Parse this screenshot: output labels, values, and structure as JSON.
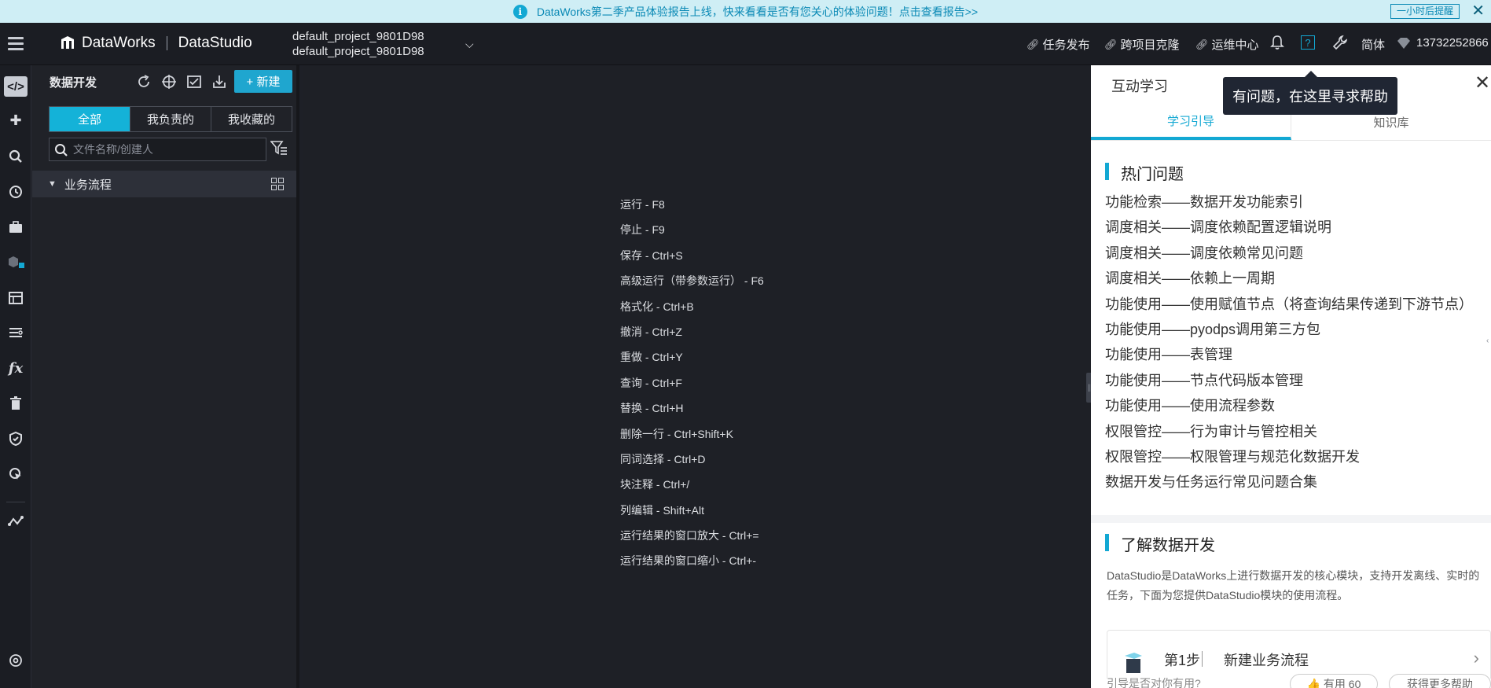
{
  "announcement": {
    "text": "DataWorks第二季产品体验报告上线，快来看看是否有您关心的体验问题！点击查看报告>>",
    "remind_label": "一小时后提醒",
    "info_glyph": "i",
    "close_glyph": "✕"
  },
  "header": {
    "brand": "DataWorks",
    "module": "DataStudio",
    "project_lines": [
      "default_project_9801D98",
      "default_project_9801D98"
    ],
    "nav": [
      {
        "label": "任务发布",
        "icon": "link-icon"
      },
      {
        "label": "跨项目克隆",
        "icon": "link-icon"
      },
      {
        "label": "运维中心",
        "icon": "link-icon"
      }
    ],
    "lang": "简体",
    "user": "13732252866",
    "help_icon_glyph": "?"
  },
  "explorer": {
    "title": "数据开发",
    "new_button": "+ 新建",
    "tabs": [
      {
        "label": "全部",
        "selected": true
      },
      {
        "label": "我负责的",
        "selected": false
      },
      {
        "label": "我收藏的",
        "selected": false
      }
    ],
    "search_placeholder": "文件名称/创建人",
    "tree": [
      {
        "label": "业务流程",
        "expanded": true
      }
    ]
  },
  "shortcuts": [
    "运行 - F8",
    "停止 - F9",
    "保存 - Ctrl+S",
    "高级运行（带参数运行） - F6",
    "格式化 - Ctrl+B",
    "撤消 - Ctrl+Z",
    "重做 - Ctrl+Y",
    "查询 - Ctrl+F",
    "替换 - Ctrl+H",
    "删除一行 - Ctrl+Shift+K",
    "同词选择 - Ctrl+D",
    "块注释 - Ctrl+/",
    "列编辑 - Shift+Alt",
    "运行结果的窗口放大 - Ctrl+=",
    "运行结果的窗口缩小 - Ctrl+-"
  ],
  "help_panel": {
    "title": "互动学习",
    "tabs": [
      {
        "label": "学习引导",
        "selected": true
      },
      {
        "label": "知识库",
        "selected": false
      }
    ],
    "hot_title": "热门问题",
    "hot_questions": [
      "功能检索——数据开发功能索引",
      "调度相关——调度依赖配置逻辑说明",
      "调度相关——调度依赖常见问题",
      "调度相关——依赖上一周期",
      "功能使用——使用赋值节点（将查询结果传递到下游节点）",
      "功能使用——pyodps调用第三方包",
      "功能使用——表管理",
      "功能使用——节点代码版本管理",
      "功能使用——使用流程参数",
      "权限管控——行为审计与管控相关",
      "权限管控——权限管理与规范化数据开发",
      "数据开发与任务运行常见问题合集"
    ],
    "learn_title": "了解数据开发",
    "learn_text": "DataStudio是DataWorks上进行数据开发的核心模块，支持开发离线、实时的任务，下面为您提供DataStudio模块的使用流程。",
    "step": {
      "number": "第1步",
      "name": "新建业务流程"
    },
    "feedback_question": "引导是否对你有用?",
    "useful_label": "👍 有用 60",
    "more_help_label": "获得更多帮助"
  },
  "tooltip": "有问题，在这里寻求帮助",
  "colors": {
    "accent": "#13a8d3",
    "announce_bg": "#cfeef5",
    "dark_bg": "#1e2027"
  }
}
